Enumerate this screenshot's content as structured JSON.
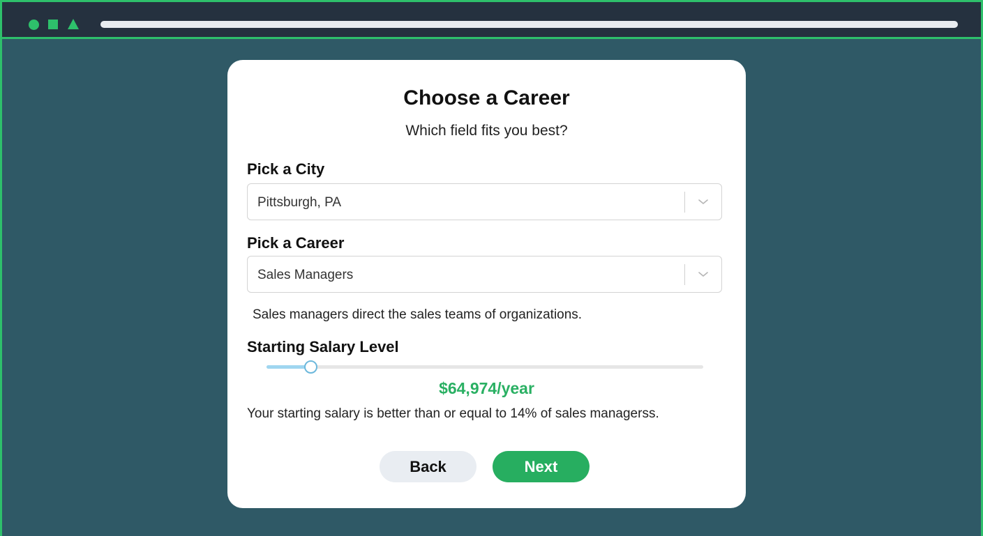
{
  "colors": {
    "accent": "#2ec06b",
    "browser_bar": "#25313f",
    "background": "#2f5966",
    "salary_green": "#2ab063",
    "next_button": "#27ae60",
    "back_button": "#e9edf2",
    "slider_fill": "#9fd6f0",
    "address_bar": "#e8ecf0"
  },
  "browser": {
    "icons": [
      "circle-icon",
      "square-icon",
      "triangle-icon"
    ]
  },
  "form": {
    "title": "Choose a Career",
    "subtitle": "Which field fits you best?",
    "city": {
      "label": "Pick a City",
      "value": "Pittsburgh, PA",
      "icon": "chevron-down-icon"
    },
    "career": {
      "label": "Pick a Career",
      "value": "Sales Managers",
      "icon": "chevron-down-icon"
    },
    "career_description": "Sales managers direct the sales teams of organizations.",
    "salary": {
      "label": "Starting Salary Level",
      "slider_level": 0.1,
      "value_text": "$64,974/year",
      "percentile_text": "Your starting salary is better than or equal to 14% of sales managerss."
    },
    "buttons": {
      "back": "Back",
      "next": "Next"
    }
  }
}
